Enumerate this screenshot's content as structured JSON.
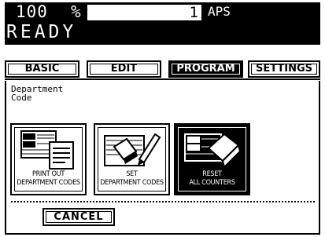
{
  "header": {
    "copies": "100",
    "percent": "%",
    "quantity": "1",
    "paper": "APS",
    "status": "READY"
  },
  "tabs": [
    {
      "label": "BASIC"
    },
    {
      "label": "EDIT"
    },
    {
      "label": "PROGRAM",
      "active": true
    },
    {
      "label": "SETTINGS"
    }
  ],
  "panel": {
    "title": "Department\nCode",
    "buttons": [
      {
        "label": "PRINT OUT\nDEPARTMENT CODES",
        "icon": "print-department-codes-icon"
      },
      {
        "label": "SET\nDEPARTMENT CODES",
        "icon": "set-department-codes-icon"
      },
      {
        "label": "RESET\nALL COUNTERS",
        "icon": "reset-counters-icon",
        "active": true
      }
    ],
    "cancel_label": "CANCEL"
  }
}
